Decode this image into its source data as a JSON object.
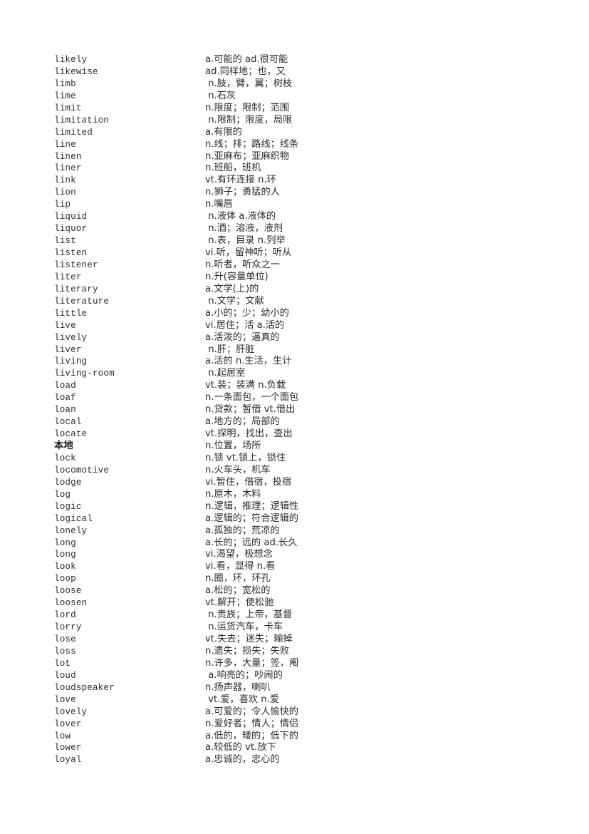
{
  "page": {
    "kind": "vocabulary-list",
    "language_pair": "English-Chinese",
    "background_color": "#ffffff",
    "text_color": "#2b2b2b",
    "row_count": 59
  },
  "entries": [
    {
      "term": "likely",
      "definition": "a.可能的 ad.很可能"
    },
    {
      "term": "likewise",
      "definition": "ad.同样地；也，又"
    },
    {
      "term": "limb",
      "definition": " n.肢，臂，翼；树枝"
    },
    {
      "term": "lime",
      "definition": " n.石灰"
    },
    {
      "term": "limit",
      "definition": "n.限度；限制；范围"
    },
    {
      "term": "limitation",
      "definition": " n.限制；限度，局限"
    },
    {
      "term": "limited",
      "definition": "a.有限的"
    },
    {
      "term": "line",
      "definition": "n.线；排；路线；线条"
    },
    {
      "term": "linen",
      "definition": "n.亚麻布；亚麻织物"
    },
    {
      "term": "liner",
      "definition": "n.班船，班机"
    },
    {
      "term": "link",
      "definition": "vt.有环连接 n.环"
    },
    {
      "term": "lion",
      "definition": "n.狮子；勇猛的人"
    },
    {
      "term": "lip",
      "definition": "n.嘴唇"
    },
    {
      "term": "liquid",
      "definition": " n.液体 a.液体的"
    },
    {
      "term": "liquor",
      "definition": " n.酒；溶液，液剂"
    },
    {
      "term": "list",
      "definition": " n.表，目录 n.列举"
    },
    {
      "term": "listen",
      "definition": "vi.听，留神听；听从"
    },
    {
      "term": "listener",
      "definition": "n.听者，听众之一"
    },
    {
      "term": "liter",
      "definition": "n.升(容量单位)"
    },
    {
      "term": "literary",
      "definition": "a.文学(上)的"
    },
    {
      "term": "literature",
      "definition": " n.文学；文献"
    },
    {
      "term": "little",
      "definition": "a.小的；少；幼小的"
    },
    {
      "term": "live",
      "definition": "vi.居住；活 a.活的"
    },
    {
      "term": "lively",
      "definition": "a.活泼的；逼真的"
    },
    {
      "term": "liver",
      "definition": " n.肝；肝脏"
    },
    {
      "term": "living",
      "definition": "a.活的 n.生活，生计"
    },
    {
      "term": "living-room",
      "definition": " n.起居室"
    },
    {
      "term": "load",
      "definition": "vt.装；装满 n.负载"
    },
    {
      "term": "loaf",
      "definition": "n.一条面包，一个面包"
    },
    {
      "term": "loan",
      "definition": "n.贷款；暂借 vt.借出"
    },
    {
      "term": "local",
      "definition": "a.地方的；局部的"
    },
    {
      "term": "locate",
      "definition": "vt.探明，找出，查出"
    },
    {
      "term": "本地",
      "definition": "n.位置，场所",
      "cjk": true
    },
    {
      "term": "lock",
      "definition": "n.锁 vt.锁上，锁住"
    },
    {
      "term": "locomotive",
      "definition": "n.火车头，机车"
    },
    {
      "term": "lodge",
      "definition": "vi.暂住，借宿，投宿"
    },
    {
      "term": "log",
      "definition": "n.原木，木料"
    },
    {
      "term": "logic",
      "definition": "n.逻辑，推理；逻辑性"
    },
    {
      "term": "logical",
      "definition": "a.逻辑的；符合逻辑的"
    },
    {
      "term": "lonely",
      "definition": "a.孤独的；荒凉的"
    },
    {
      "term": "long",
      "definition": "a.长的；远的 ad.长久"
    },
    {
      "term": "long",
      "definition": "vi.渴望，极想念"
    },
    {
      "term": "look",
      "definition": "vi.看，显得 n.看"
    },
    {
      "term": "loop",
      "definition": "n.圈，环，环孔"
    },
    {
      "term": "loose",
      "definition": "a.松的；宽松的"
    },
    {
      "term": "loosen",
      "definition": "vt.解开；使松驰"
    },
    {
      "term": "lord",
      "definition": " n.贵族；上帝，基督"
    },
    {
      "term": "lorry",
      "definition": " n.运货汽车，卡车"
    },
    {
      "term": "lose",
      "definition": "vt.失去；迷失；输掉"
    },
    {
      "term": "loss",
      "definition": "n.遗失；损失；失败"
    },
    {
      "term": "lot",
      "definition": "n.许多，大量；签，阄"
    },
    {
      "term": "loud",
      "definition": " a.响亮的；吵闹的"
    },
    {
      "term": "loudspeaker",
      "definition": "n.扬声器，喇叭"
    },
    {
      "term": "love",
      "definition": " vt.爱，喜欢 n.爱"
    },
    {
      "term": "lovely",
      "definition": "a.可爱的；令人愉快的"
    },
    {
      "term": "lover",
      "definition": "n.爱好者；情人；情侣"
    },
    {
      "term": "low",
      "definition": "a.低的，矮的；低下的"
    },
    {
      "term": "lower",
      "definition": "a.较低的 vt.放下"
    },
    {
      "term": "loyal",
      "definition": "a.忠诚的，忠心的"
    }
  ]
}
